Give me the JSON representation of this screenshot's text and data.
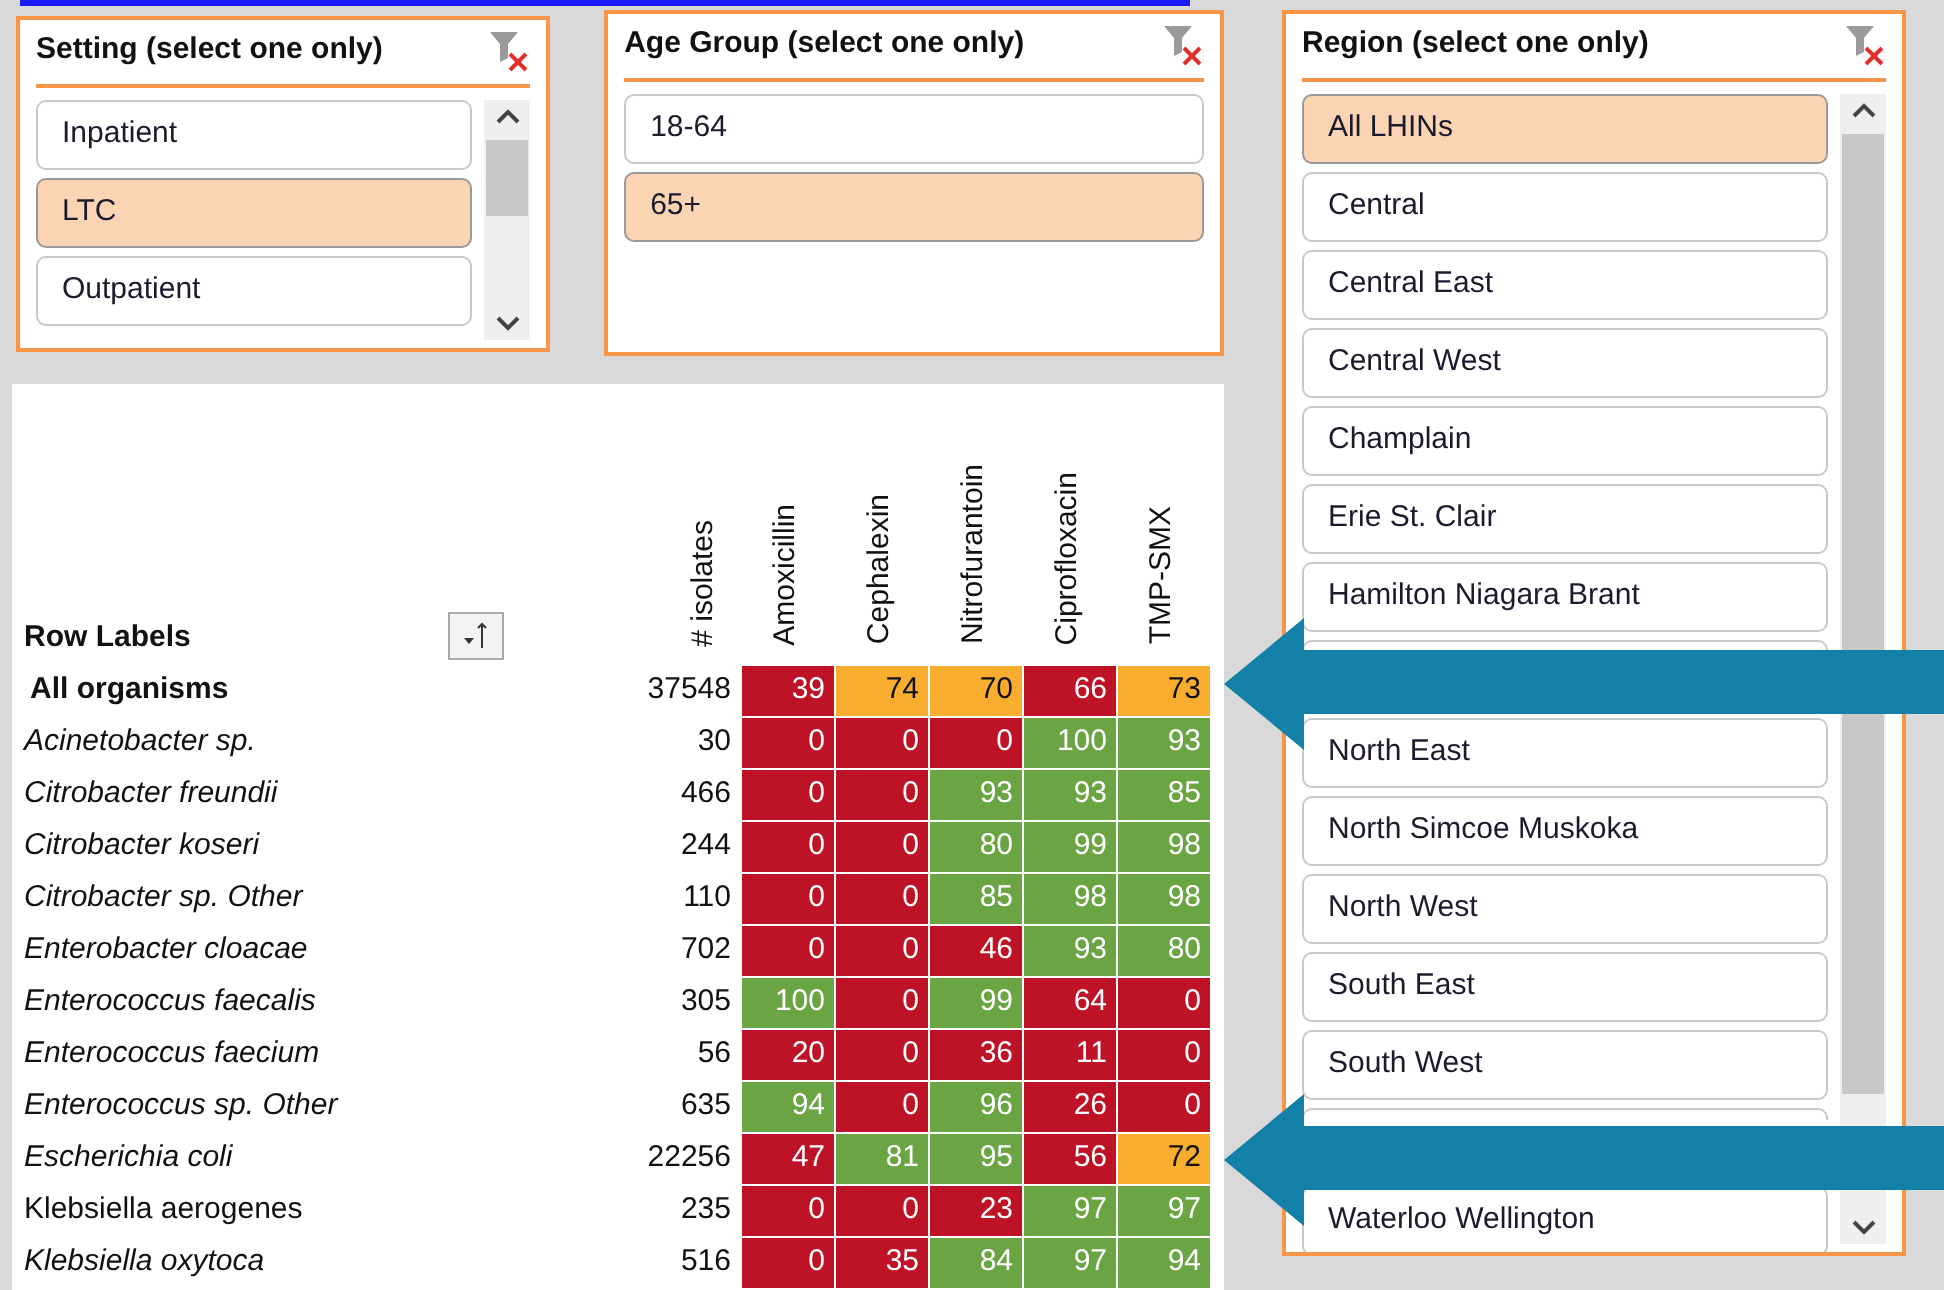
{
  "setting_slicer": {
    "title": "Setting (select one only)",
    "items": [
      {
        "label": "Inpatient",
        "selected": false
      },
      {
        "label": "LTC",
        "selected": true
      },
      {
        "label": "Outpatient",
        "selected": false
      }
    ]
  },
  "age_slicer": {
    "title": "Age Group (select one only)",
    "items": [
      {
        "label": "18-64",
        "selected": false
      },
      {
        "label": "65+",
        "selected": true
      }
    ]
  },
  "region_slicer": {
    "title": "Region (select one only)",
    "items": [
      {
        "label": "All LHINs",
        "selected": true
      },
      {
        "label": "Central",
        "selected": false
      },
      {
        "label": "Central East",
        "selected": false
      },
      {
        "label": "Central West",
        "selected": false
      },
      {
        "label": "Champlain",
        "selected": false
      },
      {
        "label": "Erie St. Clair",
        "selected": false
      },
      {
        "label": "Hamilton Niagara Brant",
        "selected": false
      },
      {
        "kind": "covered",
        "selected": false
      },
      {
        "label": "North East",
        "selected": false
      },
      {
        "label": "North Simcoe Muskoka",
        "selected": false
      },
      {
        "label": "North West",
        "selected": false
      },
      {
        "label": "South East",
        "selected": false
      },
      {
        "label": "South West",
        "selected": false
      },
      {
        "kind": "covered",
        "selected": false
      },
      {
        "label": "Waterloo Wellington",
        "selected": false
      }
    ]
  },
  "pivot_table": {
    "row_labels_header": "Row Labels",
    "isolates_header": "# isolates",
    "columns": [
      "Amoxicillin",
      "Cephalexin",
      "Nitrofurantoin",
      "Ciprofloxacin",
      "TMP-SMX"
    ],
    "rows": [
      {
        "kind": "bold",
        "label": "All organisms",
        "isolates": "37548",
        "cells": [
          {
            "value": "39",
            "color": "#be1227"
          },
          {
            "value": "74",
            "color": "#f8ad2f"
          },
          {
            "value": "70",
            "color": "#f8ad2f"
          },
          {
            "value": "66",
            "color": "#be1227"
          },
          {
            "value": "73",
            "color": "#f8ad2f"
          }
        ]
      },
      {
        "kind": "italic",
        "label": "Acinetobacter sp.",
        "isolates": "30",
        "cells": [
          {
            "value": "0",
            "color": "#be1227"
          },
          {
            "value": "0",
            "color": "#be1227"
          },
          {
            "value": "0",
            "color": "#be1227"
          },
          {
            "value": "100",
            "color": "#6aa443"
          },
          {
            "value": "93",
            "color": "#6aa443"
          }
        ]
      },
      {
        "kind": "italic",
        "label": "Citrobacter freundii",
        "isolates": "466",
        "cells": [
          {
            "value": "0",
            "color": "#be1227"
          },
          {
            "value": "0",
            "color": "#be1227"
          },
          {
            "value": "93",
            "color": "#6aa443"
          },
          {
            "value": "93",
            "color": "#6aa443"
          },
          {
            "value": "85",
            "color": "#6aa443"
          }
        ]
      },
      {
        "kind": "italic",
        "label": "Citrobacter koseri",
        "isolates": "244",
        "cells": [
          {
            "value": "0",
            "color": "#be1227"
          },
          {
            "value": "0",
            "color": "#be1227"
          },
          {
            "value": "80",
            "color": "#6aa443"
          },
          {
            "value": "99",
            "color": "#6aa443"
          },
          {
            "value": "98",
            "color": "#6aa443"
          }
        ]
      },
      {
        "kind": "italic",
        "label": "Citrobacter sp. Other",
        "isolates": "110",
        "cells": [
          {
            "value": "0",
            "color": "#be1227"
          },
          {
            "value": "0",
            "color": "#be1227"
          },
          {
            "value": "85",
            "color": "#6aa443"
          },
          {
            "value": "98",
            "color": "#6aa443"
          },
          {
            "value": "98",
            "color": "#6aa443"
          }
        ]
      },
      {
        "kind": "italic",
        "label": "Enterobacter cloacae",
        "isolates": "702",
        "cells": [
          {
            "value": "0",
            "color": "#be1227"
          },
          {
            "value": "0",
            "color": "#be1227"
          },
          {
            "value": "46",
            "color": "#be1227"
          },
          {
            "value": "93",
            "color": "#6aa443"
          },
          {
            "value": "80",
            "color": "#6aa443"
          }
        ]
      },
      {
        "kind": "italic",
        "label": "Enterococcus faecalis",
        "isolates": "305",
        "cells": [
          {
            "value": "100",
            "color": "#6aa443"
          },
          {
            "value": "0",
            "color": "#be1227"
          },
          {
            "value": "99",
            "color": "#6aa443"
          },
          {
            "value": "64",
            "color": "#be1227"
          },
          {
            "value": "0",
            "color": "#be1227"
          }
        ]
      },
      {
        "kind": "italic",
        "label": "Enterococcus faecium",
        "isolates": "56",
        "cells": [
          {
            "value": "20",
            "color": "#be1227"
          },
          {
            "value": "0",
            "color": "#be1227"
          },
          {
            "value": "36",
            "color": "#be1227"
          },
          {
            "value": "11",
            "color": "#be1227"
          },
          {
            "value": "0",
            "color": "#be1227"
          }
        ]
      },
      {
        "kind": "italic",
        "label": "Enterococcus sp. Other",
        "isolates": "635",
        "cells": [
          {
            "value": "94",
            "color": "#6aa443"
          },
          {
            "value": "0",
            "color": "#be1227"
          },
          {
            "value": "96",
            "color": "#6aa443"
          },
          {
            "value": "26",
            "color": "#be1227"
          },
          {
            "value": "0",
            "color": "#be1227"
          }
        ]
      },
      {
        "kind": "italic",
        "label": "Escherichia coli",
        "isolates": "22256",
        "cells": [
          {
            "value": "47",
            "color": "#be1227"
          },
          {
            "value": "81",
            "color": "#6aa443"
          },
          {
            "value": "95",
            "color": "#6aa443"
          },
          {
            "value": "56",
            "color": "#be1227"
          },
          {
            "value": "72",
            "color": "#f8ad2f"
          }
        ]
      },
      {
        "kind": "normal",
        "label": "Klebsiella aerogenes",
        "isolates": "235",
        "cells": [
          {
            "value": "0",
            "color": "#be1227"
          },
          {
            "value": "0",
            "color": "#be1227"
          },
          {
            "value": "23",
            "color": "#be1227"
          },
          {
            "value": "97",
            "color": "#6aa443"
          },
          {
            "value": "97",
            "color": "#6aa443"
          }
        ]
      },
      {
        "kind": "italic",
        "label": "Klebsiella oxytoca",
        "isolates": "516",
        "cells": [
          {
            "value": "0",
            "color": "#be1227"
          },
          {
            "value": "35",
            "color": "#be1227"
          },
          {
            "value": "84",
            "color": "#6aa443"
          },
          {
            "value": "97",
            "color": "#6aa443"
          },
          {
            "value": "94",
            "color": "#6aa443"
          }
        ]
      }
    ]
  }
}
